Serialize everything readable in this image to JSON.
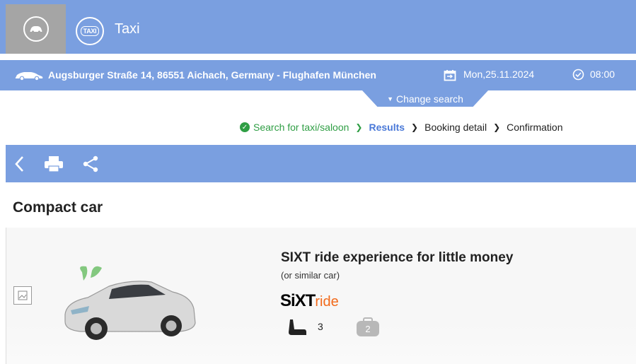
{
  "header": {
    "title": "Taxi",
    "taxi_sign": "TAXI"
  },
  "route": {
    "text": "Augsburger Straße 14, 86551 Aichach, Germany - Flughafen München",
    "date": "Mon,25.11.2024",
    "time": "08:00"
  },
  "change_search": {
    "label": "Change search"
  },
  "steps": [
    {
      "label": "Search for taxi/saloon",
      "state": "done"
    },
    {
      "label": "Results",
      "state": "active"
    },
    {
      "label": "Booking detail",
      "state": "pending"
    },
    {
      "label": "Confirmation",
      "state": "pending"
    }
  ],
  "toolbar": {
    "icons": [
      "back-icon",
      "print-icon",
      "share-icon"
    ]
  },
  "section": {
    "title": "Compact car"
  },
  "offer": {
    "title": "SIXT ride experience for little money",
    "subtitle": "(or similar car)",
    "brand_main": "SiXT",
    "brand_suffix": "ride",
    "seats": "3",
    "luggage": "2"
  },
  "colors": {
    "primary": "#7a9fe0",
    "gray_tile": "#a5a5a5",
    "success": "#2f9e44",
    "active_step": "#4a79d8",
    "brand_orange": "#f26a1b"
  }
}
